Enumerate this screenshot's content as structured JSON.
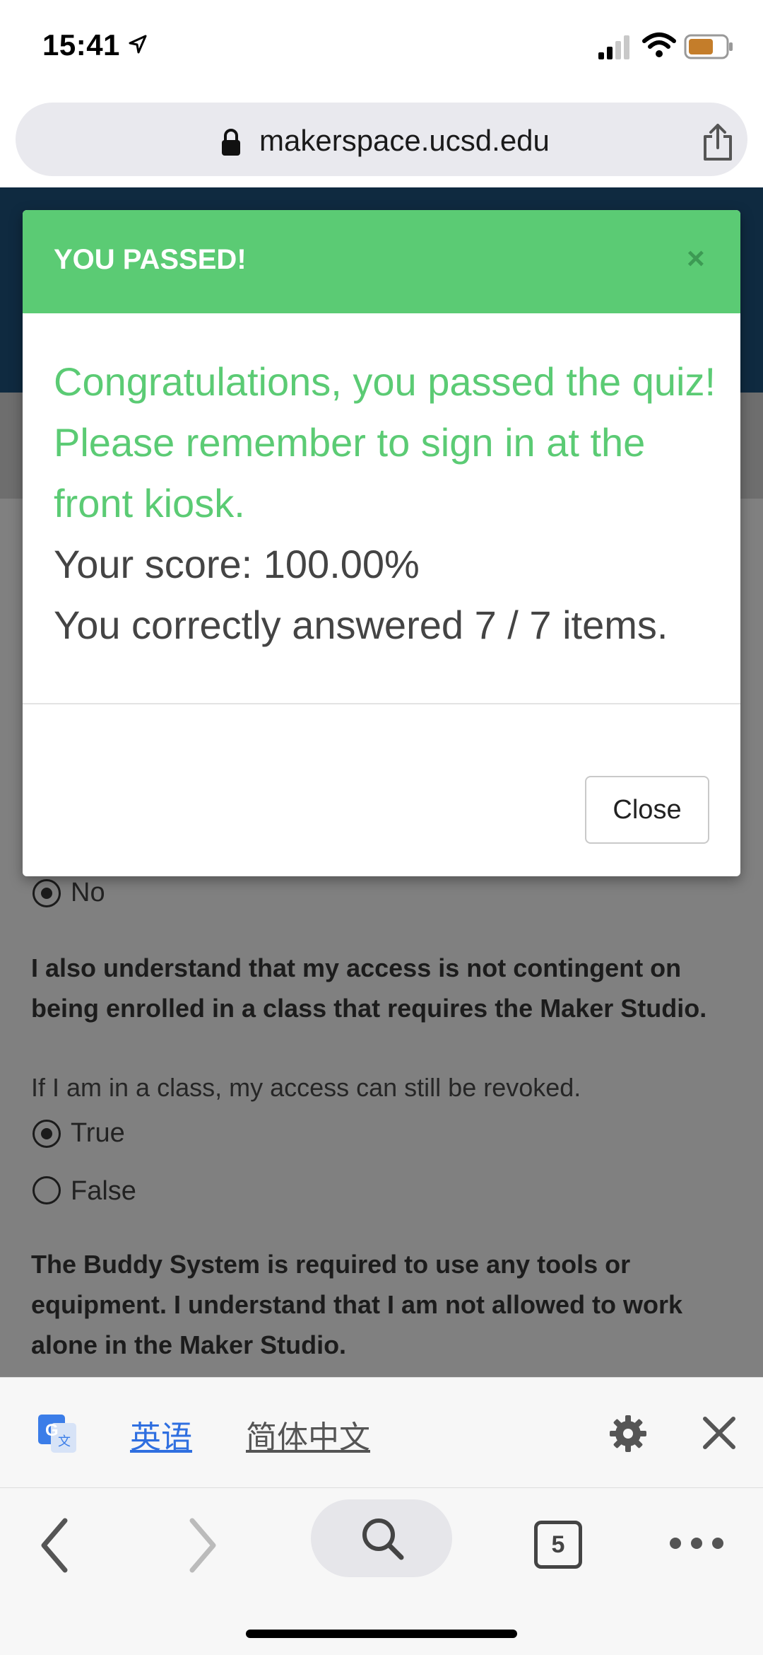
{
  "status_bar": {
    "time": "15:41"
  },
  "url_bar": {
    "url": "makerspace.ucsd.edu"
  },
  "modal": {
    "title": "YOU PASSED!",
    "close_x": "×",
    "message": "Congratulations, you passed the quiz! Please remember to sign in at the front kiosk.",
    "score": "Your score: 100.00%",
    "answered": "You correctly answered 7 / 7 items.",
    "close_button": "Close"
  },
  "quiz": {
    "prev_option": "No",
    "q2": {
      "question": "I also understand that my access is not contingent on being enrolled in a class that requires the Maker Studio.",
      "note": "If I am in a class, my access can still be revoked.",
      "options": [
        "True",
        "False"
      ],
      "selected": "True"
    },
    "q3": {
      "question": "The Buddy System is required to use any tools or equipment. I understand that I am not allowed to work alone in the Maker Studio."
    }
  },
  "translate_bar": {
    "source_lang": "英语",
    "target_lang": "简体中文"
  },
  "toolbar": {
    "tab_count": "5"
  },
  "colors": {
    "success_green": "#5bcb74",
    "header_navy": "#0f2a40",
    "link_blue": "#2f6fe0"
  }
}
